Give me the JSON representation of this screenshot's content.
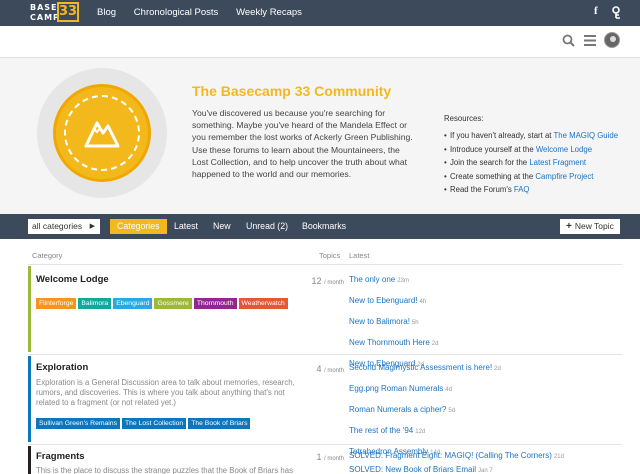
{
  "topbar": {
    "logo": {
      "line1": "BASE",
      "line2": "CAMP",
      "number": "33"
    },
    "nav": [
      "Blog",
      "Chronological Posts",
      "Weekly Recaps"
    ],
    "facebook_glyph": "f"
  },
  "banner": {
    "title": "The Basecamp 33 Community",
    "text": "You've discovered us because you're searching for something. Maybe you've heard of the Mandela Effect or you remember the lost works of Ackerly Green Publishing. Use these forums to learn about the Mountaineers, the Lost Collection, and to help uncover the truth about what happened to the world and our memories.",
    "resources_title": "Resources:",
    "resources": [
      {
        "pre": "If you haven't already, start at ",
        "link": "The MAGIQ Guide"
      },
      {
        "pre": "Introduce yourself at the ",
        "link": "Welcome Lodge"
      },
      {
        "pre": "Join the search for the ",
        "link": "Latest Fragment"
      },
      {
        "pre": "Create something at the ",
        "link": "Campfire Project"
      },
      {
        "pre": "Read the Forum's ",
        "link": "FAQ"
      }
    ]
  },
  "navbar": {
    "category_select": "all categories",
    "tabs": [
      "Categories",
      "Latest",
      "New",
      "Unread (2)",
      "Bookmarks"
    ],
    "new_topic": "New Topic"
  },
  "table": {
    "headers": {
      "category": "Category",
      "topics": "Topics",
      "latest": "Latest"
    },
    "categories": [
      {
        "name": "Welcome Lodge",
        "color": "#9eb83b",
        "description": "",
        "count": "12",
        "per": "/ month",
        "tags": [
          {
            "label": "Flinterforge",
            "color": "#f7941d"
          },
          {
            "label": "Balimora",
            "color": "#12a89d"
          },
          {
            "label": "Ebenguard",
            "color": "#25aae1"
          },
          {
            "label": "Gossmere",
            "color": "#9eb83b"
          },
          {
            "label": "Thornmouth",
            "color": "#92278f"
          },
          {
            "label": "Weatherwatch",
            "color": "#e45735"
          }
        ],
        "latest": [
          {
            "title": "The only one",
            "age": "23m"
          },
          {
            "title": "New to Ebenguard!",
            "age": "4h"
          },
          {
            "title": "New to Balimora!",
            "age": "5h"
          },
          {
            "title": "New Thornmouth Here",
            "age": "2d"
          },
          {
            "title": "New to Ebenguard",
            "age": "2d"
          }
        ]
      },
      {
        "name": "Exploration",
        "color": "#0e76bd",
        "description": "Exploration is a General Discussion area to talk about memories, research, rumors, and discoveries. This is where you talk about anything that's not related to a fragment (or not related yet.)",
        "count": "4",
        "per": "/ month",
        "tags": [
          {
            "label": "Sullivan Green's Remains",
            "color": "#0e76bd"
          },
          {
            "label": "The Lost Collection",
            "color": "#0e76bd"
          },
          {
            "label": "The Book of Briars",
            "color": "#0e76bd"
          }
        ],
        "latest": [
          {
            "title": "Second Magimystic Assessment is here!",
            "age": "2d"
          },
          {
            "title": "Egg.png Roman Numerals",
            "age": "4d"
          },
          {
            "title": "Roman Numerals a cipher?",
            "age": "5d"
          },
          {
            "title": "The rest of the '94",
            "age": "12d"
          },
          {
            "title": "Tetrahedron Assembly",
            "age": "14d"
          }
        ]
      },
      {
        "name": "Fragments",
        "color": "#231f20",
        "description": "This is the place to discuss the strange puzzles that the Book of Briars has",
        "count": "1",
        "per": "/ month",
        "tags": [],
        "latest": [
          {
            "title": "SOLVED: Fragment Eight: MAGIQ! (Calling The Corners)",
            "age": "21d"
          },
          {
            "title": "SOLVED: New Book of Briars Email",
            "age": "Jan 7"
          }
        ]
      }
    ]
  }
}
